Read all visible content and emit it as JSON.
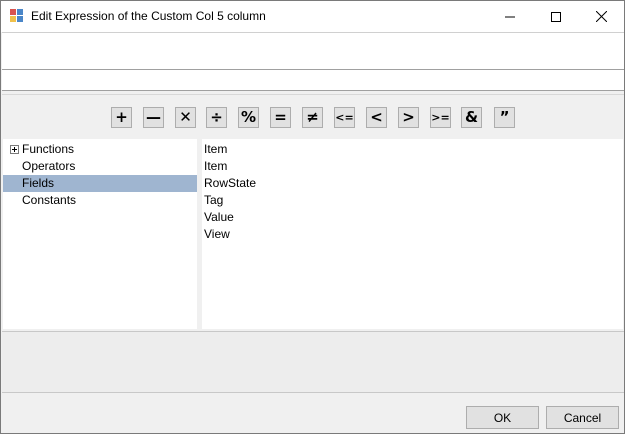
{
  "window": {
    "title": "Edit Expression of the Custom Col 5 column",
    "app_icon": "form-app-icon",
    "controls": {
      "minimize_icon": "minimize-icon",
      "maximize_icon": "maximize-icon",
      "close_icon": "close-icon"
    }
  },
  "expression": {
    "text": "",
    "line_text": ""
  },
  "operators": [
    {
      "name": "plus",
      "symbol": "+"
    },
    {
      "name": "minus",
      "symbol": "—"
    },
    {
      "name": "multiply",
      "symbol": "✕"
    },
    {
      "name": "divide",
      "symbol": "÷"
    },
    {
      "name": "percent",
      "symbol": "%"
    },
    {
      "name": "equals",
      "symbol": "="
    },
    {
      "name": "not-equals",
      "symbol": "≠"
    },
    {
      "name": "less-or-equal",
      "symbol": "<="
    },
    {
      "name": "less-than",
      "symbol": "<"
    },
    {
      "name": "greater-than",
      "symbol": ">"
    },
    {
      "name": "greater-or-equal",
      "symbol": ">="
    },
    {
      "name": "ampersand",
      "symbol": "&"
    },
    {
      "name": "quotes",
      "symbol": "”"
    }
  ],
  "tree": {
    "items": [
      {
        "label": "Functions",
        "expandable": true,
        "selected": false
      },
      {
        "label": "Operators",
        "expandable": false,
        "selected": false
      },
      {
        "label": "Fields",
        "expandable": false,
        "selected": true
      },
      {
        "label": "Constants",
        "expandable": false,
        "selected": false
      }
    ]
  },
  "fields_list": {
    "items": [
      "Item",
      "Item",
      "RowState",
      "Tag",
      "Value",
      "View"
    ]
  },
  "description": {
    "text": ""
  },
  "buttons": {
    "ok_label": "OK",
    "cancel_label": "Cancel"
  },
  "colors": {
    "selection": "#9fb5d0",
    "button_face": "#e1e1e1",
    "dialog_bg": "#f0f0f0"
  }
}
